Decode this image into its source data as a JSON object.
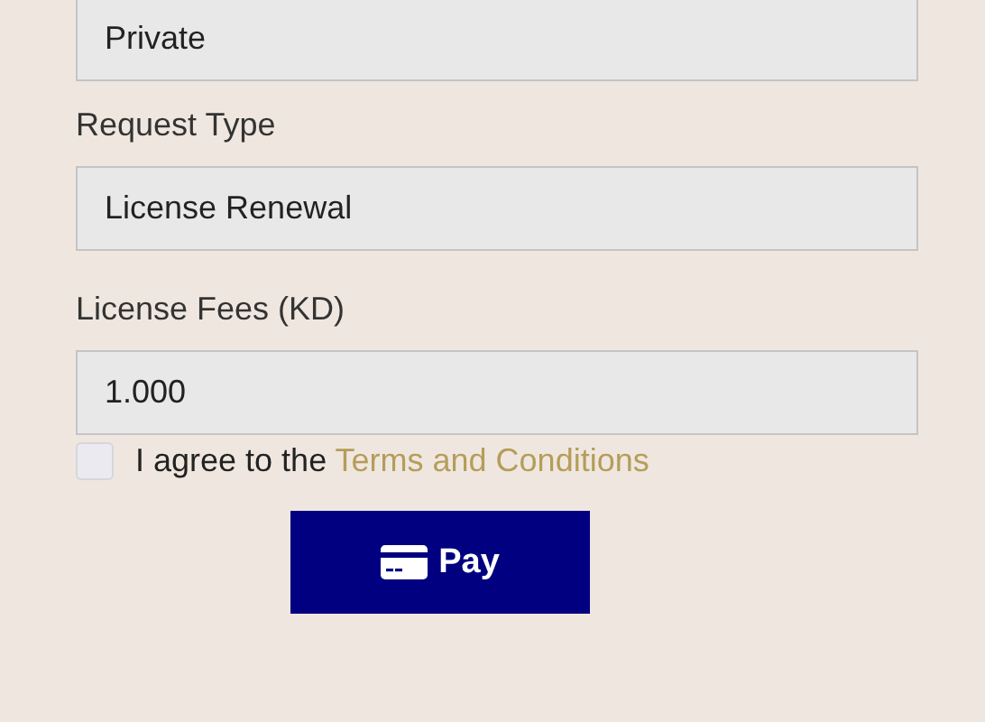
{
  "fields": [
    {
      "value": "Private"
    },
    {
      "label": "Request Type",
      "value": "License Renewal"
    },
    {
      "label": "License Fees (KD)",
      "value": "1.000"
    }
  ],
  "agreement": {
    "checked": false,
    "text": "I agree to the",
    "link": "Terms and Conditions"
  },
  "pay_button": {
    "label": "Pay"
  }
}
